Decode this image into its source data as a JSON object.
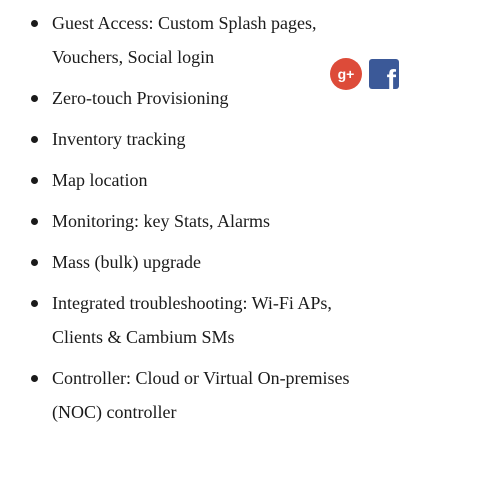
{
  "features": [
    {
      "lines": [
        "Guest Access: Custom Splash pages,",
        "Vouchers, Social login"
      ]
    },
    {
      "lines": [
        "Zero-touch Provisioning"
      ]
    },
    {
      "lines": [
        "Inventory tracking"
      ]
    },
    {
      "lines": [
        "Map location"
      ]
    },
    {
      "lines": [
        "Monitoring: key Stats, Alarms"
      ]
    },
    {
      "lines": [
        "Mass (bulk) upgrade"
      ]
    },
    {
      "lines": [
        "Integrated troubleshooting: Wi-Fi APs,",
        "Clients & Cambium SMs"
      ]
    },
    {
      "lines": [
        "Controller: Cloud or Virtual On-premises",
        "(NOC) controller"
      ]
    }
  ],
  "social_icons": [
    {
      "icon": "google-plus-icon",
      "glyph": "g+",
      "color": "#dd4b39"
    },
    {
      "icon": "facebook-icon",
      "glyph": "f",
      "color": "#3b5998"
    }
  ]
}
